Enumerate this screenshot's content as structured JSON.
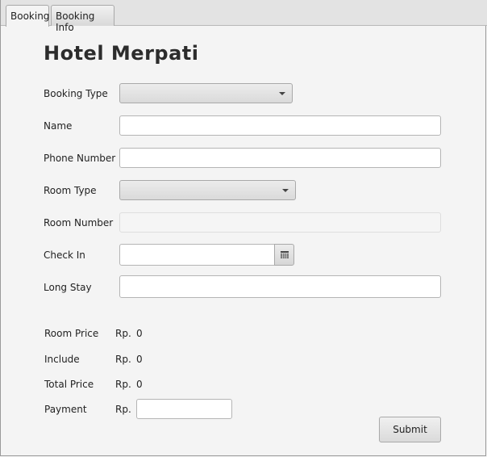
{
  "tabs": [
    {
      "label": "Booking"
    },
    {
      "label": "Booking Info"
    }
  ],
  "form": {
    "title": "Hotel Merpati",
    "booking_type": {
      "label": "Booking Type",
      "value": ""
    },
    "name": {
      "label": "Name",
      "value": ""
    },
    "phone": {
      "label": "Phone Number",
      "value": ""
    },
    "room_type": {
      "label": "Room Type",
      "value": ""
    },
    "room_number": {
      "label": "Room Number",
      "value": ""
    },
    "check_in": {
      "label": "Check In",
      "value": ""
    },
    "long_stay": {
      "label": "Long Stay",
      "value": ""
    }
  },
  "summary": {
    "currency": "Rp.",
    "room_price": {
      "label": "Room Price",
      "value": "0"
    },
    "include": {
      "label": "Include",
      "value": "0"
    },
    "total_price": {
      "label": "Total Price",
      "value": "0"
    },
    "payment": {
      "label": "Payment",
      "value": ""
    }
  },
  "actions": {
    "submit_label": "Submit"
  },
  "icons": {
    "calendar": "calendar-icon",
    "dropdown": "chevron-down-icon"
  }
}
